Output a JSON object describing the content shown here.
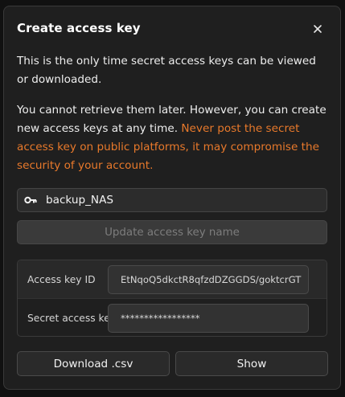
{
  "dialog": {
    "title": "Create access key",
    "close_icon": "close-icon",
    "notice": "This is the only time secret access keys can be viewed or downloaded.",
    "info_text": "You cannot retrieve them later. However, you can create new access keys at any time. ",
    "warning_text": "Never post the secret access key on public platforms, it may compromise the security of your account.",
    "warning_color": "#e8792b",
    "key_name": {
      "icon": "key-icon",
      "value": "backup_NAS"
    },
    "update_button_label": "Update access key name",
    "keys": {
      "access_key_id_label": "Access key ID",
      "access_key_id_value": "EtNqoQ5dkctR8qfzdDZGGDS/goktcrGT",
      "secret_access_key_label": "Secret access key",
      "secret_access_key_value": "*****************"
    },
    "download_button_label": "Download .csv",
    "show_button_label": "Show"
  }
}
